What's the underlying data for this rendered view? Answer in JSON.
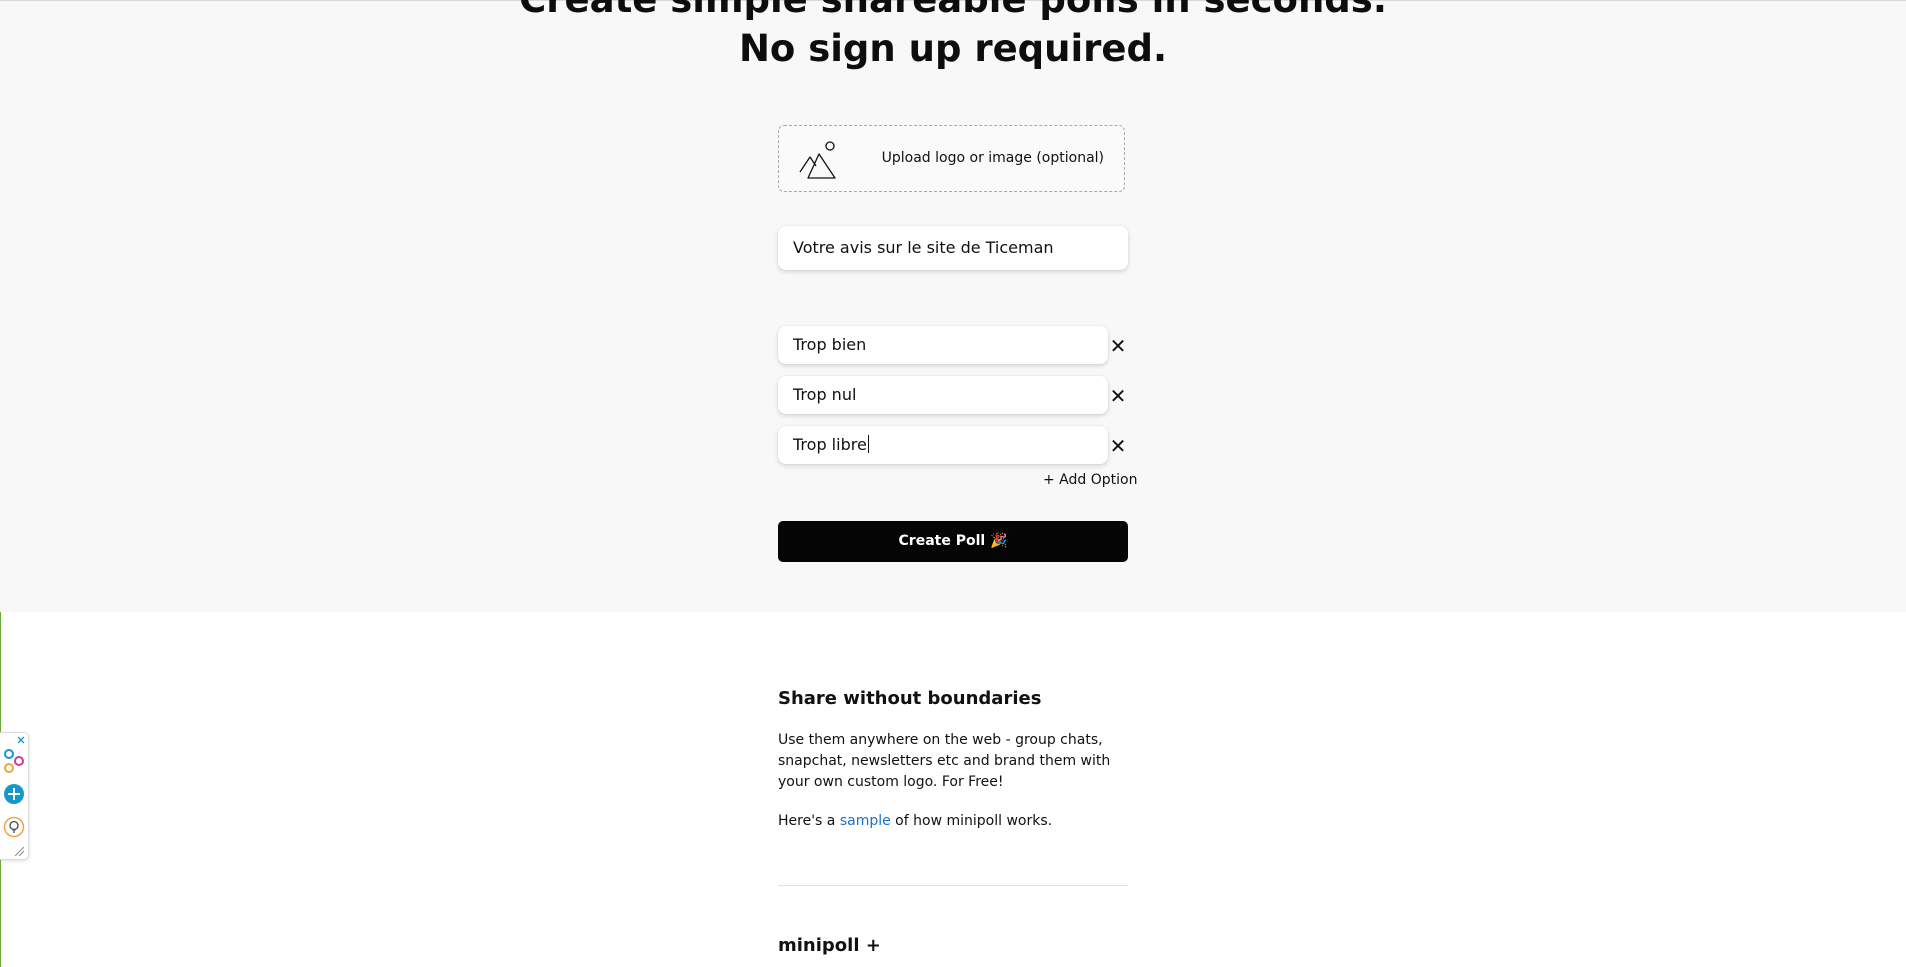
{
  "hero": {
    "title_line1": "Create simple shareable polls in seconds.",
    "title_line2": "No sign up required."
  },
  "upload": {
    "label": "Upload logo or image (optional)",
    "icon": "image-upload-icon"
  },
  "poll": {
    "question": "Votre avis sur le site de Ticeman",
    "options": [
      "Trop bien",
      "Trop nul",
      "Trop libre"
    ],
    "remove_icon_glyph": "✕",
    "add_option_label": "+ Add Option",
    "create_label": "Create Poll 🎉"
  },
  "share_section": {
    "title": "Share without boundaries",
    "body": "Use them anywhere on the web - group chats, snapchat, newsletters etc and brand them with your own custom logo. For Free!",
    "sample_prefix": "Here's a ",
    "sample_link": "sample",
    "sample_suffix": " of how minipoll works."
  },
  "plus_section": {
    "title": "minipoll +"
  },
  "extension_widget": {
    "icons": [
      "close-icon",
      "share-circles-icon",
      "add-icon",
      "lightbulb-icon",
      "resize-icon"
    ]
  },
  "colors": {
    "hero_background": "#f8f8f8",
    "button_background": "#050505",
    "link": "#1a73c8",
    "accent_left_border": "#6cab3e",
    "widget_blue": "#1697c9"
  }
}
